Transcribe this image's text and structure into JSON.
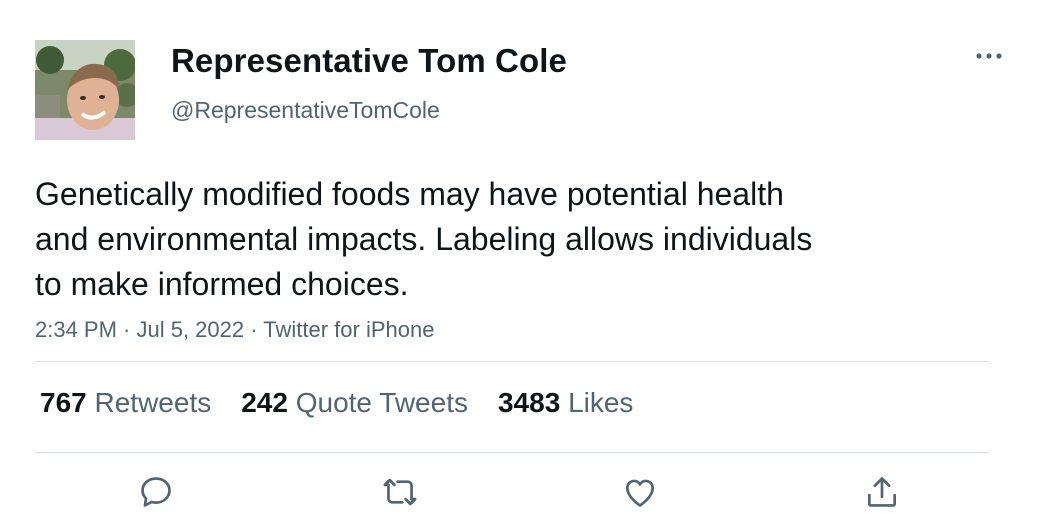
{
  "tweet": {
    "author_name": "Representative Tom Cole",
    "author_handle": "@RepresentativeTomCole",
    "text_lines": [
      "Genetically modified foods may have potential health",
      "and environmental impacts. Labeling allows individuals",
      "to make informed choices."
    ],
    "meta": "2:34 PM · Jul 5, 2022 · Twitter for iPhone"
  },
  "stats": {
    "retweets_count": "767",
    "retweets_label": "Retweets",
    "quotes_count": "242",
    "quotes_label": "Quote Tweets",
    "likes_count": "3483",
    "likes_label": "Likes"
  },
  "icons": {
    "more": "more-horizontal-icon",
    "reply": "reply-icon",
    "retweet": "retweet-icon",
    "like": "heart-icon",
    "share": "share-icon"
  },
  "colors": {
    "text": "#0f1419",
    "secondary": "#536471",
    "divider": "#d9dee2"
  }
}
